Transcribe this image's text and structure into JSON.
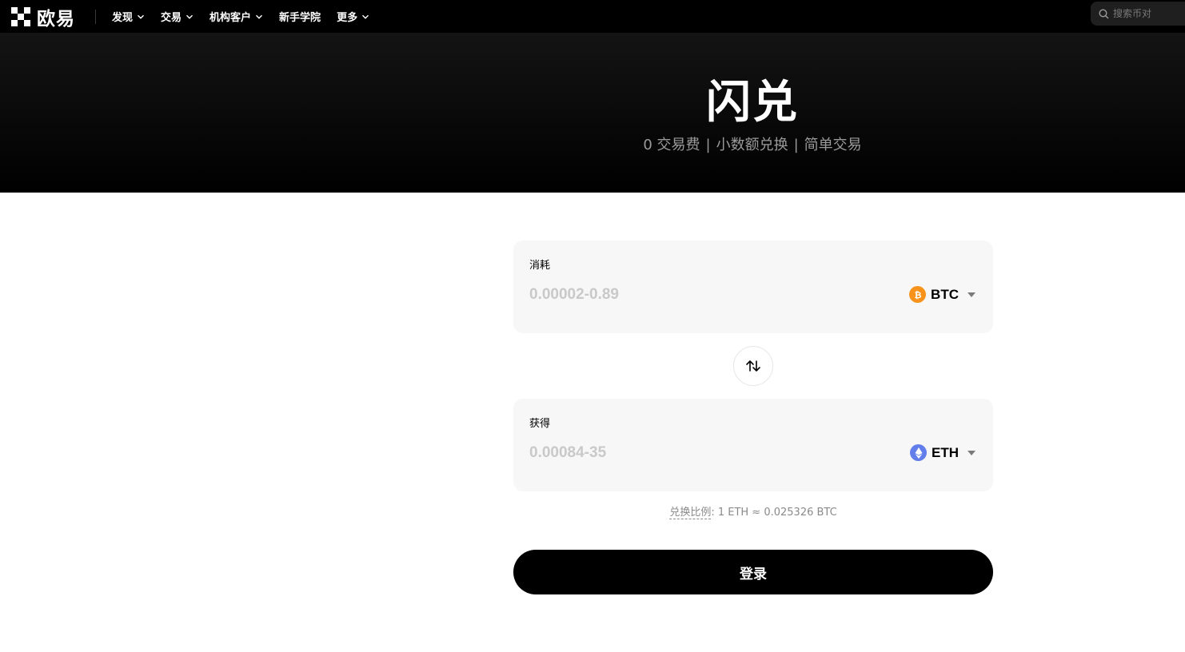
{
  "nav": {
    "logo_text": "欧易",
    "items": [
      {
        "label": "发现",
        "has_dropdown": true
      },
      {
        "label": "交易",
        "has_dropdown": true
      },
      {
        "label": "机构客户",
        "has_dropdown": true
      },
      {
        "label": "新手学院",
        "has_dropdown": false
      },
      {
        "label": "更多",
        "has_dropdown": true
      }
    ],
    "search_placeholder": "搜索币对"
  },
  "hero": {
    "title": "闪兑",
    "features": [
      "0 交易费",
      "小数额兑换",
      "简单交易"
    ],
    "separator": "|"
  },
  "from_panel": {
    "label": "消耗",
    "placeholder": "0.00002-0.89",
    "value": "",
    "coin": "BTC",
    "coin_color": "#F7931A",
    "coin_icon": "bitcoin-icon"
  },
  "to_panel": {
    "label": "获得",
    "placeholder": "0.00084-35",
    "value": "",
    "coin": "ETH",
    "coin_color": "#627EEA",
    "coin_icon": "ethereum-icon"
  },
  "rate": {
    "label": "兑换比例",
    "text": ": 1 ETH ≈ 0.025326 BTC"
  },
  "login_button": "登录",
  "colors": {
    "nav_bg": "#000000",
    "panel_bg": "#f7f7f7",
    "primary_button": "#000000"
  }
}
